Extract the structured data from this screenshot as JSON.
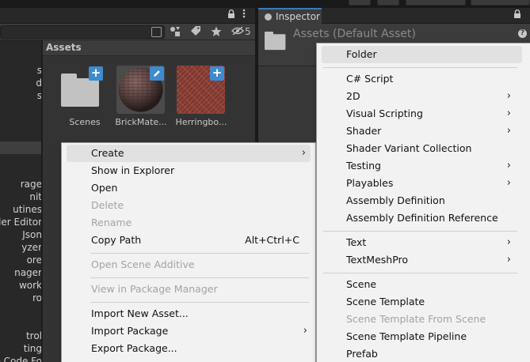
{
  "project_panel": {
    "tab_icons": {
      "lock": "lock-icon",
      "more": "more-vertical-icon"
    },
    "toolbar": {
      "hidden_count": "5"
    },
    "assets_header": "Assets",
    "assets": [
      {
        "name": "Scenes",
        "kind": "folder"
      },
      {
        "name": "BrickMate...",
        "kind": "material"
      },
      {
        "name": "Herringbo...",
        "kind": "texture"
      }
    ],
    "tree_fragments": [
      "s",
      "d",
      "s",
      "rage",
      "nit",
      "utines",
      "der Editor",
      "Json",
      "yzer",
      "ore",
      "nager",
      "work",
      "ro",
      "trol",
      "ting",
      "rce Code Fo"
    ]
  },
  "inspector": {
    "tab_label": "Inspector",
    "header_title": "Assets (Default Asset)"
  },
  "context_menu": {
    "items": [
      {
        "label": "Create",
        "has_submenu": true,
        "highlighted": true
      },
      {
        "label": "Show in Explorer"
      },
      {
        "label": "Open"
      },
      {
        "label": "Delete",
        "disabled": true
      },
      {
        "label": "Rename",
        "disabled": true
      },
      {
        "label": "Copy Path",
        "shortcut": "Alt+Ctrl+C"
      },
      {
        "label": "Open Scene Additive",
        "disabled": true
      },
      {
        "label": "View in Package Manager",
        "disabled": true
      },
      {
        "label": "Import New Asset..."
      },
      {
        "label": "Import Package",
        "has_submenu": true
      },
      {
        "label": "Export Package..."
      }
    ]
  },
  "create_submenu": {
    "items": [
      {
        "label": "Folder",
        "highlighted": true
      },
      {
        "label": "C# Script"
      },
      {
        "label": "2D",
        "has_submenu": true
      },
      {
        "label": "Visual Scripting",
        "has_submenu": true
      },
      {
        "label": "Shader",
        "has_submenu": true
      },
      {
        "label": "Shader Variant Collection"
      },
      {
        "label": "Testing",
        "has_submenu": true
      },
      {
        "label": "Playables",
        "has_submenu": true
      },
      {
        "label": "Assembly Definition"
      },
      {
        "label": "Assembly Definition Reference"
      },
      {
        "label": "Text",
        "has_submenu": true
      },
      {
        "label": "TextMeshPro",
        "has_submenu": true
      },
      {
        "label": "Scene"
      },
      {
        "label": "Scene Template"
      },
      {
        "label": "Scene Template From Scene",
        "disabled": true
      },
      {
        "label": "Scene Template Pipeline"
      },
      {
        "label": "Prefab"
      }
    ]
  },
  "colors": {
    "accent": "#3d8bd0",
    "menu_background": "#f2f2f2",
    "editor_background": "#383838"
  }
}
